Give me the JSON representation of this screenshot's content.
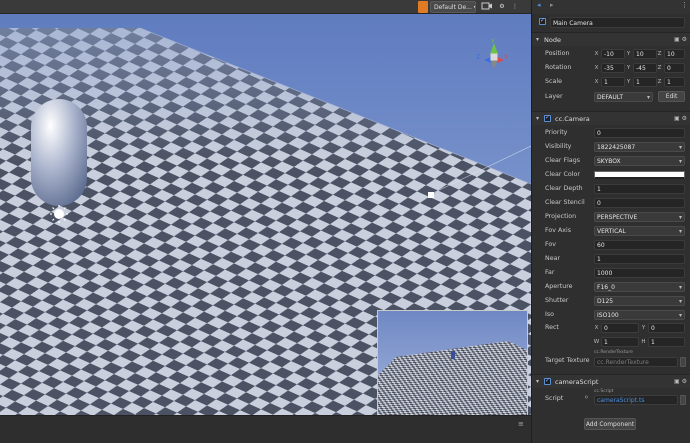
{
  "scene": {
    "toolbar": {
      "dropdown_label": "Default De...",
      "camera_icon": "camera-icon",
      "gear_icon": "gear-icon",
      "more_icon": "more-icon"
    },
    "gizmo": {
      "x": "X",
      "y": "Y",
      "z": "Z"
    },
    "bottom_grip": "≡"
  },
  "inspector": {
    "nav": {
      "back": "◂",
      "forward": "▸",
      "more": "⋮"
    },
    "node_name": "Main Camera",
    "node_section": {
      "title": "Node",
      "position": {
        "label": "Position",
        "x": "-10",
        "y": "10",
        "z": "10"
      },
      "rotation": {
        "label": "Rotation",
        "x": "-35",
        "y": "-45",
        "z": "0"
      },
      "scale": {
        "label": "Scale",
        "x": "1",
        "y": "1",
        "z": "1"
      },
      "layer": {
        "label": "Layer",
        "value": "DEFAULT",
        "edit": "Edit"
      }
    },
    "camera_section": {
      "title": "cc.Camera",
      "priority": {
        "label": "Priority",
        "value": "0"
      },
      "visibility": {
        "label": "Visibility",
        "value": "1822425087"
      },
      "clear_flags": {
        "label": "Clear Flags",
        "value": "SKYBOX"
      },
      "clear_color": {
        "label": "Clear Color"
      },
      "clear_depth": {
        "label": "Clear Depth",
        "value": "1"
      },
      "clear_stencil": {
        "label": "Clear Stencil",
        "value": "0"
      },
      "projection": {
        "label": "Projection",
        "value": "PERSPECTIVE"
      },
      "fov_axis": {
        "label": "Fov Axis",
        "value": "VERTICAL"
      },
      "fov": {
        "label": "Fov",
        "value": "60"
      },
      "near": {
        "label": "Near",
        "value": "1"
      },
      "far": {
        "label": "Far",
        "value": "1000"
      },
      "aperture": {
        "label": "Aperture",
        "value": "F16_0"
      },
      "shutter": {
        "label": "Shutter",
        "value": "D125"
      },
      "iso": {
        "label": "Iso",
        "value": "ISO100"
      },
      "rect": {
        "label": "Rect",
        "x": "0",
        "y": "0",
        "w": "1",
        "h": "1",
        "ax": "X",
        "ay": "Y",
        "aw": "W",
        "ah": "H"
      },
      "target_texture": {
        "label": "Target Texture",
        "tag": "cc.RenderTexture",
        "placeholder": "cc.RenderTexture"
      }
    },
    "script_section": {
      "title": "cameraScript",
      "script": {
        "label": "Script",
        "tag": "cc.Script",
        "value": "cameraScript.ts"
      }
    },
    "add_component": "Add Component"
  },
  "colors": {
    "accent_blue": "#4a90e2",
    "sky": "#7b95c9",
    "checker_light": "#c9cfdc",
    "checker_dark": "#4b5263"
  }
}
